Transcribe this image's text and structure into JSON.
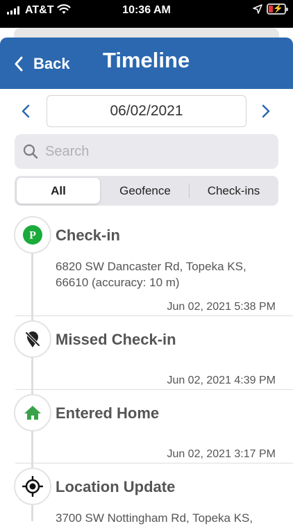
{
  "status_bar": {
    "carrier": "AT&T",
    "time": "10:36 AM",
    "icons": [
      "signal-icon",
      "wifi-icon",
      "location-arrow-icon",
      "battery-charging-icon"
    ]
  },
  "nav": {
    "back_label": "Back",
    "title": "Timeline",
    "color": "#2b68b0"
  },
  "date": "06/02/2021",
  "search": {
    "placeholder": "Search"
  },
  "filter_tabs": {
    "items": [
      "All",
      "Geofence",
      "Check-ins"
    ],
    "selected": "All"
  },
  "events": [
    {
      "title": "Check-in",
      "icon": "parking-checkin-icon",
      "address": "6820 SW Dancaster Rd, Topeka KS, 66610 (accuracy: 10 m)",
      "time": "Jun 02, 2021 5:38 PM"
    },
    {
      "title": "Missed Check-in",
      "icon": "missed-location-pin-icon",
      "time": "Jun 02, 2021 4:39 PM"
    },
    {
      "title": "Entered Home",
      "icon": "home-icon",
      "time": "Jun 02, 2021 3:17 PM"
    },
    {
      "title": "Location Update",
      "icon": "crosshair-icon",
      "address": "3700 SW Nottingham Rd, Topeka KS,"
    }
  ],
  "colors": {
    "checkin_green": "#1aab3a",
    "home_green": "#3aa24a",
    "chevron_blue": "#2b68b0"
  }
}
